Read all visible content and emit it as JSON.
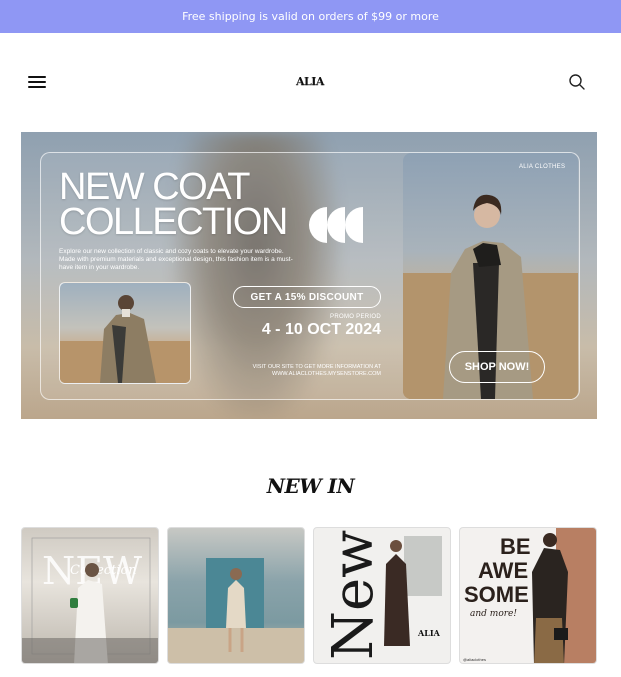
{
  "announcement": {
    "text": "Free shipping is valid on orders of $99 or more"
  },
  "header": {
    "logo": "ALIA"
  },
  "hero": {
    "title_line1": "NEW COAT",
    "title_line2": "COLLECTION",
    "description": "Explore our new collection of classic and cozy coats to elevate your wardrobe. Made with premium materials and exceptional design, this fashion item is a must-have item in your wardrobe.",
    "discount_label": "GET A 15% DISCOUNT",
    "promo_label": "PROMO PERIOD",
    "promo_dates": "4 - 10 OCT 2024",
    "visit_line1": "VISIT OUR SITE TO GET MORE INFORMATION AT",
    "visit_line2": "WWW.ALIACLOTHES.MYSENSTORE.COM",
    "brand_tag": "ALIA CLOTHES",
    "shop_label": "SHOP NOW!"
  },
  "new_in": {
    "title": "NEW IN",
    "products": [
      {
        "overlay_text": "NEW",
        "script_text": "Collection"
      },
      {
        "overlay_text": ""
      },
      {
        "overlay_text": "New",
        "logo": "ALIA"
      },
      {
        "overlay_text_lines": [
          "BE",
          "AWE",
          "SOME"
        ],
        "script_text": "and more!",
        "handle": "@aliaclothes"
      }
    ]
  },
  "colors": {
    "announcement_bg": "#8f97f4"
  },
  "icons": {
    "menu": "hamburger-icon",
    "search": "search-icon"
  }
}
